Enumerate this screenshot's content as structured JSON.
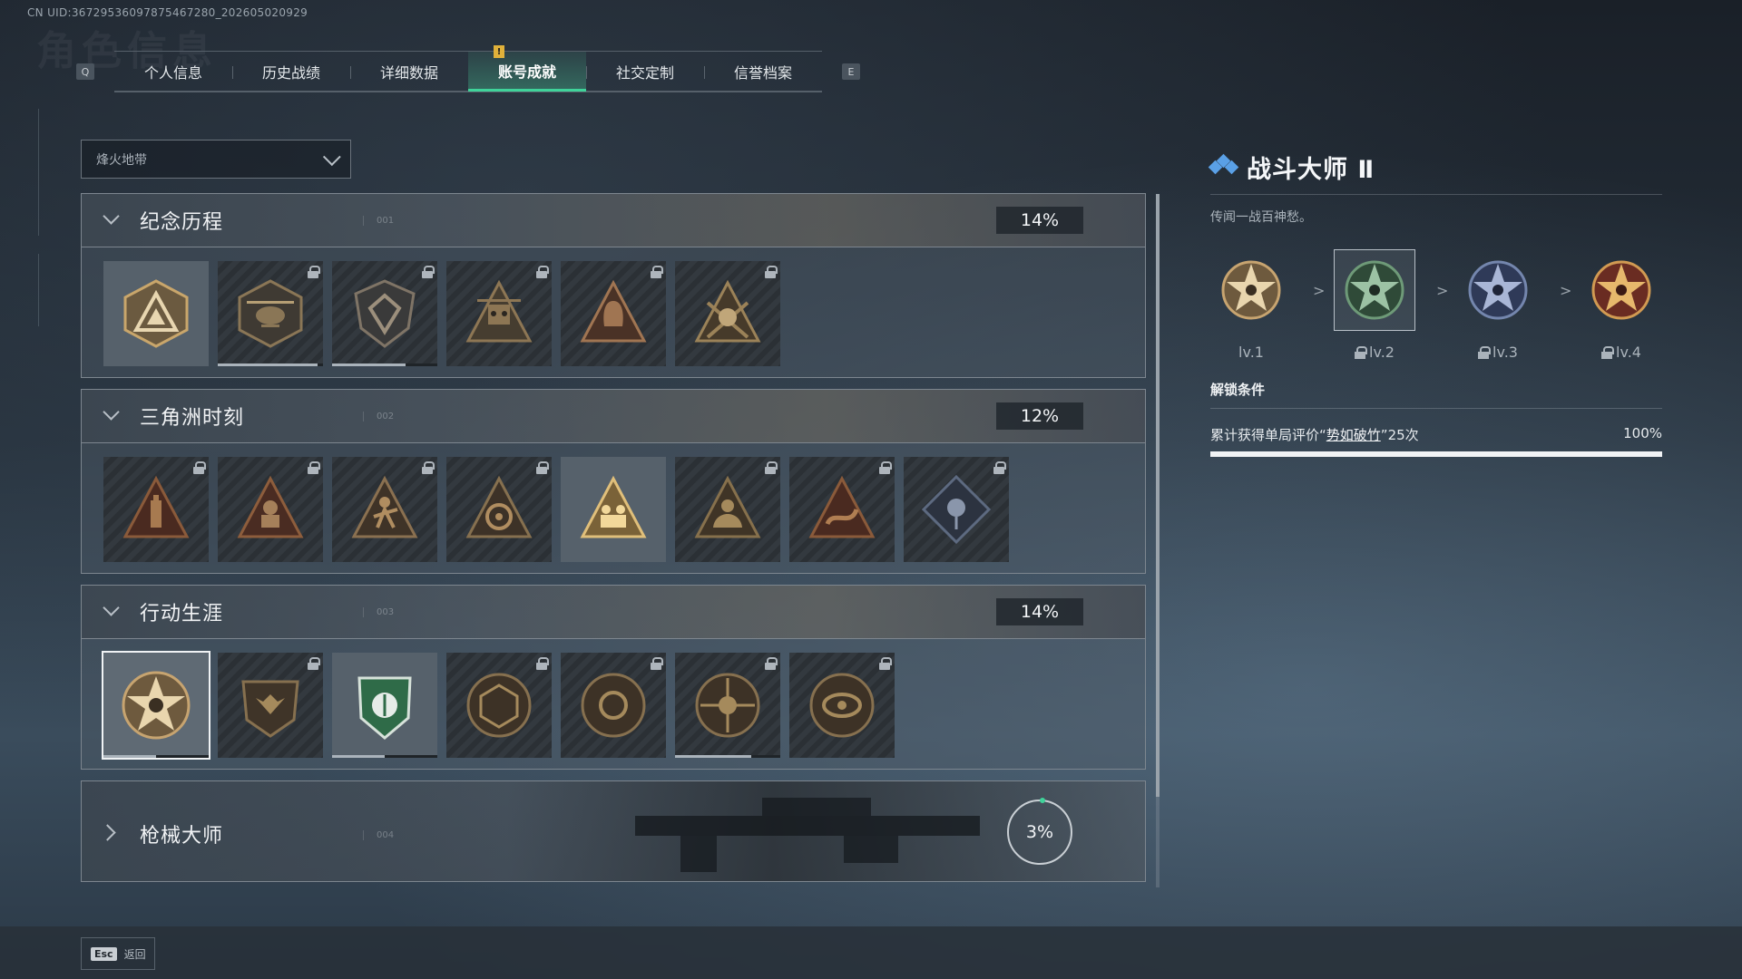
{
  "uid": "CN UID:3672953609787546728​0_202605020929",
  "bg_title": "角色信息",
  "tabs": {
    "left_key": "Q",
    "right_key": "E",
    "items": [
      {
        "label": "个人信息",
        "active": false
      },
      {
        "label": "历史战绩",
        "active": false
      },
      {
        "label": "详细数据",
        "active": false
      },
      {
        "label": "账号成就",
        "active": true,
        "alert": "!"
      },
      {
        "label": "社交定制",
        "active": false
      },
      {
        "label": "信誉档案",
        "active": false
      }
    ]
  },
  "mode_select": {
    "value": "烽火地带"
  },
  "sections": [
    {
      "title": "纪念历程",
      "code": "001",
      "percent": "14%",
      "expanded": true,
      "badges": [
        {
          "icon": "triangle-badge-icon",
          "locked": false,
          "style": "light"
        },
        {
          "icon": "helicopter-badge-icon",
          "locked": true,
          "progress": 0.95
        },
        {
          "icon": "shield-badge-icon",
          "locked": true,
          "progress": 0.7
        },
        {
          "icon": "robot-badge-icon",
          "locked": true
        },
        {
          "icon": "hooded-figure-badge-icon",
          "locked": true
        },
        {
          "icon": "skull-crossed-badge-icon",
          "locked": true
        }
      ]
    },
    {
      "title": "三角洲时刻",
      "code": "002",
      "percent": "12%",
      "expanded": true,
      "badges": [
        {
          "icon": "bottle-triangle-icon",
          "locked": true
        },
        {
          "icon": "operator-triangle-icon",
          "locked": true
        },
        {
          "icon": "runner-triangle-icon",
          "locked": true
        },
        {
          "icon": "gear-triangle-icon",
          "locked": true
        },
        {
          "icon": "squad-triangle-icon",
          "locked": false,
          "style": "light"
        },
        {
          "icon": "beast-triangle-icon",
          "locked": true
        },
        {
          "icon": "serpent-triangle-icon",
          "locked": true
        },
        {
          "icon": "rose-diamond-icon",
          "locked": true
        }
      ]
    },
    {
      "title": "行动生涯",
      "code": "003",
      "percent": "14%",
      "expanded": true,
      "badges": [
        {
          "icon": "star-skull-medal-icon",
          "locked": false,
          "selected": true,
          "progress": 0.5
        },
        {
          "icon": "eagle-shield-icon",
          "locked": true
        },
        {
          "icon": "green-shield-icon",
          "locked": false,
          "style": "light",
          "progress": 0.5
        },
        {
          "icon": "d20-medal-icon",
          "locked": true
        },
        {
          "icon": "orb-medal-icon",
          "locked": true
        },
        {
          "icon": "crosshair-skull-medal-icon",
          "locked": true,
          "progress": 0.72
        },
        {
          "icon": "eye-medal-icon",
          "locked": true
        }
      ]
    },
    {
      "title": "枪械大师",
      "code": "004",
      "percent": "3%",
      "expanded": false
    }
  ],
  "detail": {
    "title": "战斗大师 Ⅱ",
    "description": "传闻一战百神愁。",
    "levels": [
      {
        "label": "lv.1",
        "locked": false,
        "color": "#b79a6a"
      },
      {
        "label": "lv.2",
        "locked": true,
        "current": true,
        "color": "#4f7a5a"
      },
      {
        "label": "lv.3",
        "locked": true,
        "color": "#5a6f9a"
      },
      {
        "label": "lv.4",
        "locked": true,
        "color": "#a4553f"
      }
    ],
    "unlock_title": "解锁条件",
    "condition_prefix": "累计获得单局评价“",
    "condition_highlight": "势如破竹",
    "condition_suffix": "”25次",
    "condition_percent": "100%",
    "condition_progress": 1.0
  },
  "footer": {
    "esc_key": "Esc",
    "esc_label": "返回"
  }
}
